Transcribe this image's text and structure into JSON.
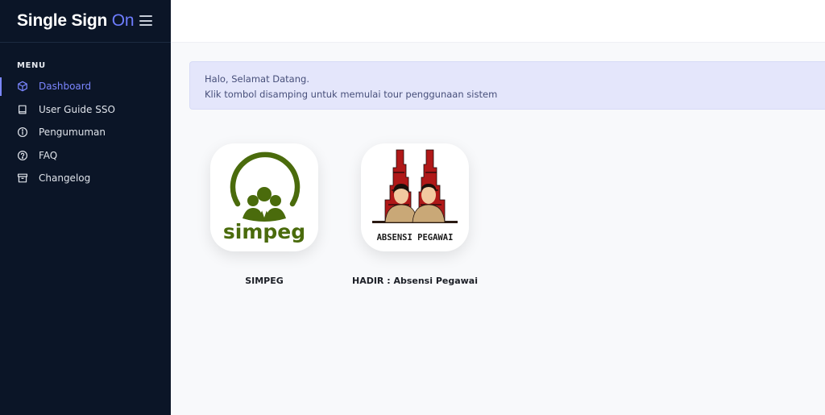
{
  "brand": {
    "title": "Single Sign",
    "accent": "On"
  },
  "menu": {
    "heading": "MENU",
    "items": [
      {
        "label": "Dashboard",
        "icon": "cube-icon",
        "active": true
      },
      {
        "label": "User Guide SSO",
        "icon": "book-icon"
      },
      {
        "label": "Pengumuman",
        "icon": "info-icon"
      },
      {
        "label": "FAQ",
        "icon": "help-circle-icon"
      },
      {
        "label": "Changelog",
        "icon": "archive-icon"
      }
    ]
  },
  "alert": {
    "line1": "Halo, Selamat Datang.",
    "line2": "Klik tombol disamping untuk memulai tour penggunaan sistem"
  },
  "apps": [
    {
      "name": "SIMPEG",
      "logo_text": "simpeg"
    },
    {
      "name": "HADIR : Absensi Pegawai",
      "logo_text": "ABSENSI PEGAWAI"
    }
  ],
  "colors": {
    "sidebar_bg": "#0b1527",
    "accent": "#7b86ff",
    "alert_bg": "#e4e6fb",
    "simpeg_green": "#4a6b0c"
  }
}
